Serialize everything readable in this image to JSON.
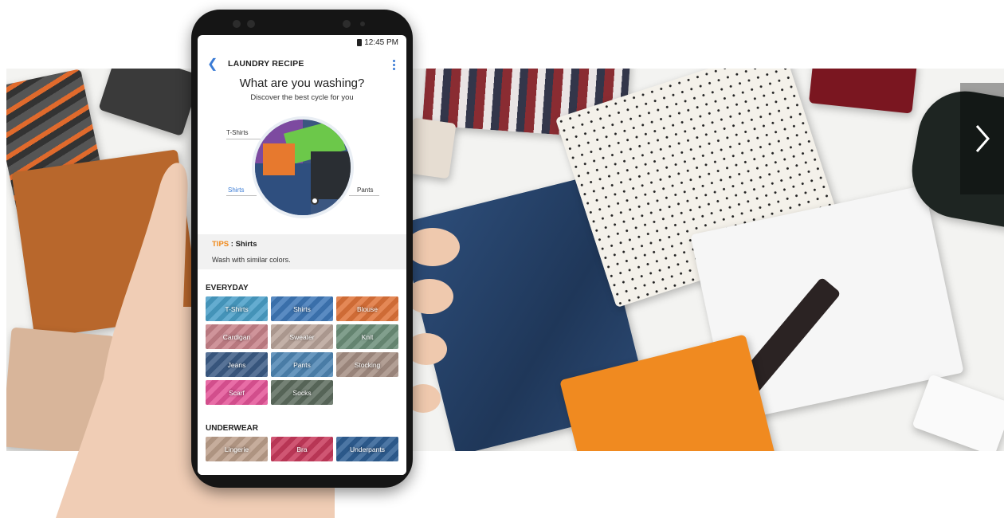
{
  "status_bar": {
    "time": "12:45 PM"
  },
  "app": {
    "title": "LAUNDRY RECIPE"
  },
  "hero": {
    "title": "What are you washing?",
    "subtitle": "Discover the best cycle for you"
  },
  "wheel": {
    "labels": {
      "top": "T-Shirts",
      "left": "Shirts",
      "right": "Pants"
    }
  },
  "tips": {
    "prefix": "TIPS",
    "separator": " : ",
    "topic": "Shirts",
    "body": "Wash with similar colors."
  },
  "everyday": {
    "heading": "EVERYDAY",
    "items": [
      {
        "label": "T-Shirts",
        "color": "#4a9fc8"
      },
      {
        "label": "Shirts",
        "color": "#3f78b8"
      },
      {
        "label": "Blouse",
        "color": "#e0743a"
      },
      {
        "label": "Cardigan",
        "color": "#c7828a"
      },
      {
        "label": "Sweater",
        "color": "#b9a49a"
      },
      {
        "label": "Knit",
        "color": "#6c8f7a"
      },
      {
        "label": "Jeans",
        "color": "#3c5c86"
      },
      {
        "label": "Pants",
        "color": "#4f86b4"
      },
      {
        "label": "Stocking",
        "color": "#a68f84"
      },
      {
        "label": "Scarf",
        "color": "#e45598"
      },
      {
        "label": "Socks",
        "color": "#5d6c5e"
      }
    ]
  },
  "underwear": {
    "heading": "UNDERWEAR",
    "items": [
      {
        "label": "Lingerie",
        "color": "#bda08c"
      },
      {
        "label": "Bra",
        "color": "#c83a5c"
      },
      {
        "label": "Underpants",
        "color": "#2f5f95"
      }
    ]
  },
  "carousel": {
    "next_icon": "chevron-right-icon"
  }
}
